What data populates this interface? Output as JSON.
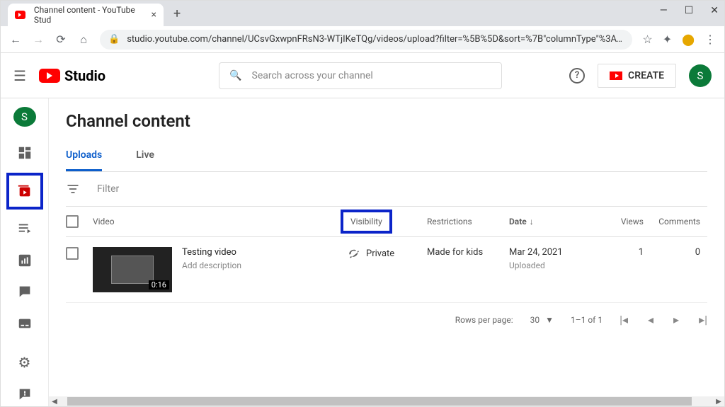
{
  "browser": {
    "tab_title": "Channel content - YouTube Stud",
    "url": "studio.youtube.com/channel/UCsvGxwpnFRsN3-WTjIKeTQg/videos/upload?filter=%5B%5D&sort=%7B\"columnType\"%3A\"..."
  },
  "header": {
    "logo_text": "Studio",
    "search_placeholder": "Search across your channel",
    "create_label": "CREATE",
    "avatar_initial": "S"
  },
  "sidebar": {
    "avatar_initial": "S"
  },
  "page": {
    "title": "Channel content",
    "tabs": {
      "uploads": "Uploads",
      "live": "Live"
    },
    "filter_label": "Filter"
  },
  "columns": {
    "video": "Video",
    "visibility": "Visibility",
    "restrictions": "Restrictions",
    "date": "Date",
    "views": "Views",
    "comments": "Comments"
  },
  "rows": [
    {
      "title": "Testing video",
      "desc": "Add description",
      "duration": "0:16",
      "visibility": "Private",
      "restrictions": "Made for kids",
      "date": "Mar 24, 2021",
      "date_sub": "Uploaded",
      "views": "1",
      "comments": "0"
    }
  ],
  "pager": {
    "rows_label": "Rows per page:",
    "rows_value": "30",
    "range": "1–1 of 1"
  }
}
